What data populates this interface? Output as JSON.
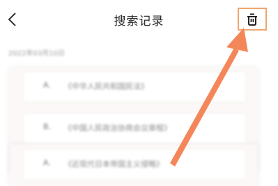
{
  "header": {
    "back_icon": "chevron-left-icon",
    "title": "搜索记录",
    "delete_icon": "trash-icon"
  },
  "content": {
    "date": "2022年03月10日",
    "items": [
      {
        "letter": "A.",
        "text": "《中华人民共和国民法》"
      },
      {
        "letter": "B.",
        "text": "《中国人民政治协商会议章程》"
      },
      {
        "letter": "A.",
        "text": "《近现代日本帝国主义侵略》"
      }
    ]
  },
  "colors": {
    "highlight_border": "#f0a56e",
    "arrow": "#f4875a"
  }
}
